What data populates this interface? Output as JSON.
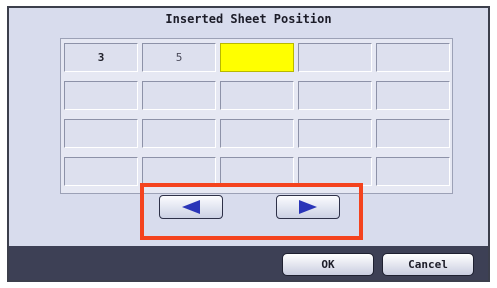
{
  "dialog": {
    "title": "Inserted Sheet Position"
  },
  "grid": {
    "rows": [
      [
        "3",
        "5",
        "",
        "",
        ""
      ],
      [
        "",
        "",
        "",
        "",
        ""
      ],
      [
        "",
        "",
        "",
        "",
        ""
      ],
      [
        "",
        "",
        "",
        "",
        ""
      ]
    ],
    "current_cell": "yellow-highlighted cell after 5"
  },
  "nav": {
    "prev_icon": "left-arrow-icon",
    "next_icon": "right-arrow-icon"
  },
  "buttons": {
    "ok": "OK",
    "cancel": "Cancel"
  },
  "colors": {
    "current_cell": "#ffff00",
    "highlight_box": "#f4431e",
    "footer": "#3d4055",
    "arrow": "#2a35b8"
  }
}
